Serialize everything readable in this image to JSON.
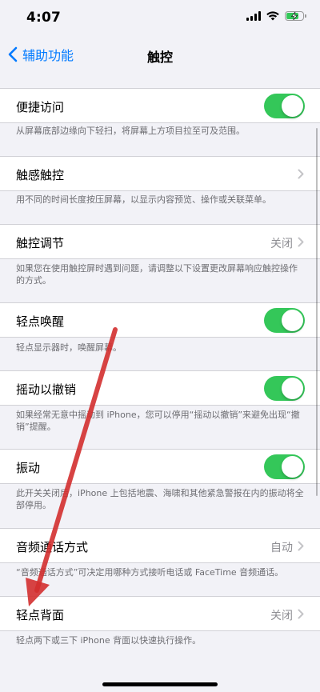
{
  "status": {
    "time": "4:07"
  },
  "nav": {
    "back_label": "辅助功能",
    "title": "触控"
  },
  "settings": [
    {
      "label": "便捷访问",
      "value": "",
      "control": "toggle",
      "on": true,
      "footer": "从屏幕底部边缘向下轻扫，将屏幕上方项目拉至可及范围。"
    },
    {
      "label": "触感触控",
      "value": "",
      "control": "chevron",
      "footer": "用不同的时间长度按压屏幕，以显示内容预览、操作或关联菜单。"
    },
    {
      "label": "触控调节",
      "value": "关闭",
      "control": "chevron",
      "footer": "如果您在使用触控屏时遇到问题，请调整以下设置更改屏幕响应触控操作的方式。"
    },
    {
      "label": "轻点唤醒",
      "value": "",
      "control": "toggle",
      "on": true,
      "footer": "轻点显示器时，唤醒屏幕。"
    },
    {
      "label": "摇动以撤销",
      "value": "",
      "control": "toggle",
      "on": true,
      "footer": "如果经常无意中摇动到 iPhone，您可以停用“摇动以撤销”来避免出现“撤销”提醒。"
    },
    {
      "label": "振动",
      "value": "",
      "control": "toggle",
      "on": true,
      "footer": "此开关关闭后，iPhone 上包括地震、海啸和其他紧急警报在内的振动将全部停用。"
    },
    {
      "label": "音频通话方式",
      "value": "自动",
      "control": "chevron",
      "footer": "“音频通话方式”可决定用哪种方式接听电话或 FaceTime 音频通话。"
    },
    {
      "label": "轻点背面",
      "value": "关闭",
      "control": "chevron",
      "footer": "轻点两下或三下 iPhone 背面以快速执行操作。"
    }
  ],
  "colors": {
    "accent": "#007aff",
    "toggle_on": "#34c759",
    "annotation_arrow": "#d32f2f",
    "background": "#f2f2f7"
  },
  "icons": {
    "back": "chevron-left-icon",
    "disclosure": "chevron-right-icon",
    "signal": "cellular-signal-icon",
    "wifi": "wifi-icon",
    "battery": "battery-charging-icon"
  }
}
